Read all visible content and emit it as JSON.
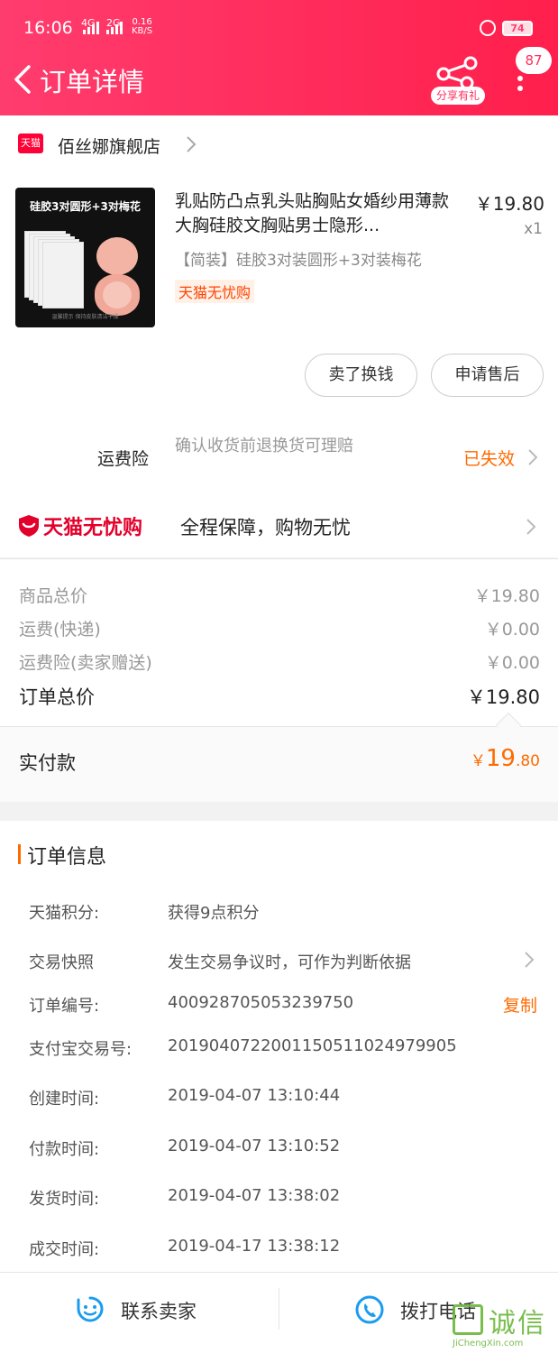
{
  "status_bar": {
    "time": "16:06",
    "net1": "4G",
    "net2": "2G",
    "speed_value": "0.16",
    "speed_unit": "KB/S",
    "battery": "74"
  },
  "header": {
    "title": "订单详情",
    "share_label": "分享有礼",
    "message_count": "87"
  },
  "shop": {
    "logo_text": "天猫",
    "name": "佰丝娜旗舰店"
  },
  "product": {
    "thumb_title": "硅胶3对圆形+3对梅花",
    "thumb_footer": "温馨提示  保持皮肤清洁干燥",
    "name": "乳贴防凸点乳头贴胸贴女婚纱用薄款大胸硅胶文胸贴男士隐形...",
    "price": "￥19.80",
    "quantity": "x1",
    "sku": "【简装】硅胶3对装圆形+3对装梅花",
    "tag": "天猫无忧购"
  },
  "actions": {
    "sell": "卖了换钱",
    "after_sale": "申请售后"
  },
  "insurance": {
    "label": "运费险",
    "desc": "确认收货前退换货可理赔",
    "status": "已失效"
  },
  "wuyou": {
    "brand": "天猫无忧购",
    "slogan": "全程保障，购物无忧"
  },
  "summary": {
    "rows": [
      {
        "label": "商品总价",
        "value": "￥19.80"
      },
      {
        "label": "运费(快递)",
        "value": "￥0.00"
      },
      {
        "label": "运费险(卖家赠送)",
        "value": "￥0.00"
      }
    ],
    "total_label": "订单总价",
    "total_value": "￥19.80",
    "paid_label": "实付款",
    "paid_currency": "￥",
    "paid_int": "19",
    "paid_dec": ".80"
  },
  "order_info": {
    "title": "订单信息",
    "rows": [
      {
        "key": "天猫积分:",
        "value": "获得9点积分"
      },
      {
        "key": "交易快照",
        "value": "发生交易争议时，可作为判断依据"
      },
      {
        "key": "订单编号:",
        "value": "400928705053239750"
      },
      {
        "key": "支付宝交易号:",
        "value": "2019040722001150511024979905"
      },
      {
        "key": "创建时间:",
        "value": "2019-04-07 13:10:44"
      },
      {
        "key": "付款时间:",
        "value": "2019-04-07 13:10:52"
      },
      {
        "key": "发货时间:",
        "value": "2019-04-07 13:38:02"
      },
      {
        "key": "成交时间:",
        "value": "2019-04-17 13:38:12"
      }
    ],
    "copy_label": "复制"
  },
  "bottom_bar": {
    "contact": "联系卖家",
    "call": "拨打电话"
  },
  "watermark": {
    "cn": "诚信",
    "en": "JiChengXin.com"
  },
  "colors": {
    "header_start": "#ff3c6e",
    "header_end": "#ff1f4c",
    "accent_orange": "#ff6a00",
    "tmall_red": "#e3002b"
  }
}
